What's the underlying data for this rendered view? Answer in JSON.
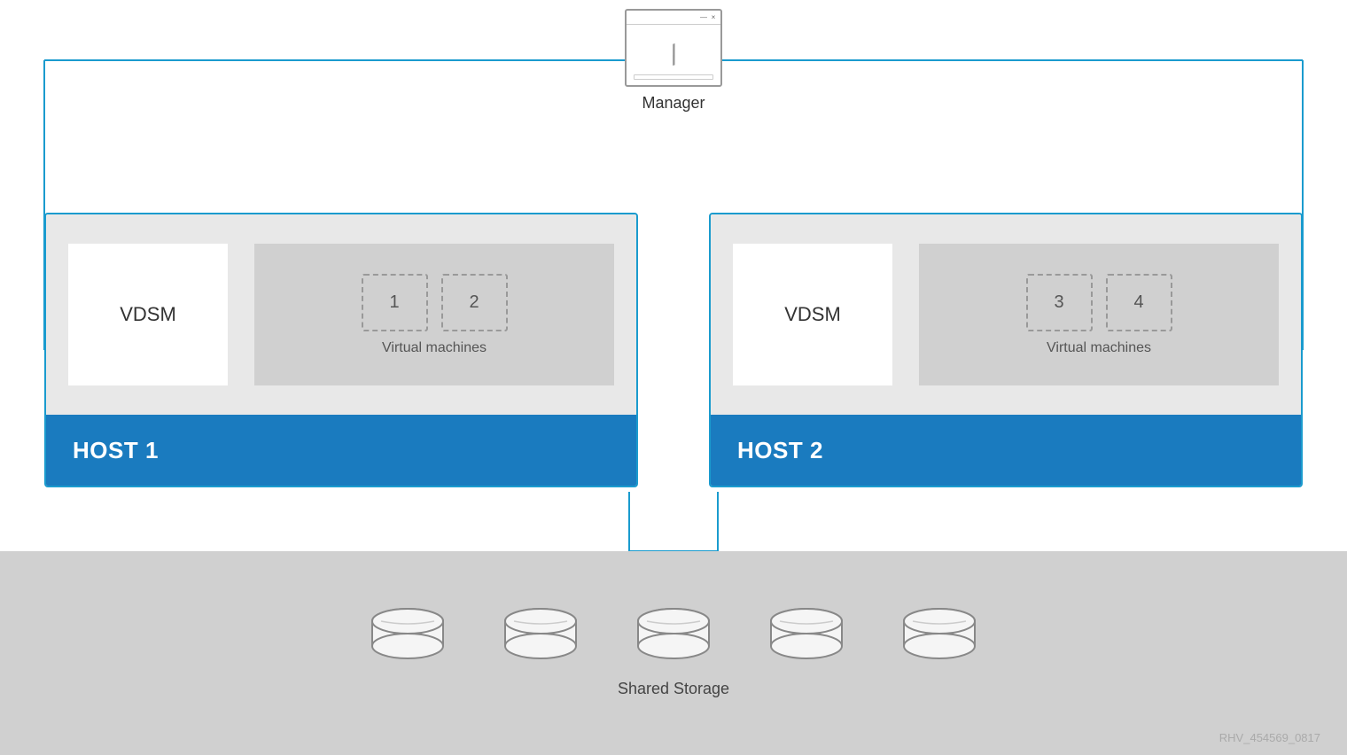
{
  "manager": {
    "label": "Manager",
    "window": {
      "minimize_btn": "—",
      "close_btn": "×"
    }
  },
  "hosts": [
    {
      "id": "host1",
      "name": "HOST 1",
      "vdsm_label": "VDSM",
      "vms_label": "Virtual machines",
      "vm_numbers": [
        "1",
        "2"
      ]
    },
    {
      "id": "host2",
      "name": "HOST 2",
      "vdsm_label": "VDSM",
      "vms_label": "Virtual machines",
      "vm_numbers": [
        "3",
        "4"
      ]
    }
  ],
  "storage": {
    "label": "Shared Storage",
    "disk_count": 5
  },
  "watermark": {
    "text": "RHV_454569_0817"
  },
  "colors": {
    "blue_border": "#1a9bce",
    "host_blue": "#1a7bbf",
    "storage_bg": "#d0d0d0",
    "host_content_bg": "#e8e8e8",
    "vm_area_bg": "#d0d0d0"
  }
}
